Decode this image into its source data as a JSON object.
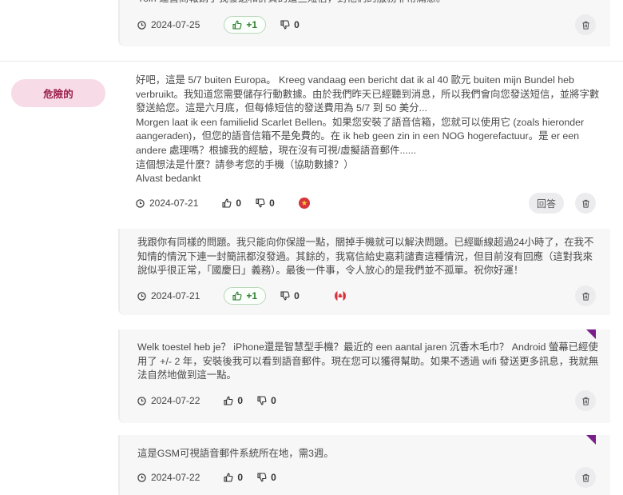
{
  "badge": {
    "label": "危險的"
  },
  "reply_label": "回答",
  "posts": [
    {
      "text": "Yoin 運營商報銷了我發送和計費的這些短信，對他們的服務非常滿意。",
      "date": "2024-07-25",
      "likes": "+1",
      "dislikes": "0"
    },
    {
      "text": "好吧，這是 5/7 buiten Europa。 Kreeg vandaag een bericht dat ik al 40 歐元 buiten mijn Bundel heb verbruikt。我知道您需要儲存行動數據。由於我們昨天已經聽到消息，所以我們會向您發送短信，並將字數發送給您。這是六月底，但每條短信的發送費用為 5/7 到 50 美分...\nMorgen laat ik een familielid Scarlet Bellen。如果您安裝了語音信箱，您就可以使用它 (zoals hieronder aangeraden)，但您的語音信箱不是免費的。在 ik heb geen zin in een NOG hogerefactuur。是 er een andere 處理嗎？根據我的經驗，現在沒有可視/虛擬語音郵件......\n這個想法是什麼？請參考您的手機（協助數據？）\nAlvast bedankt",
      "date": "2024-07-21",
      "likes": "0",
      "dislikes": "0"
    },
    {
      "text": "我跟你有同樣的問題。我只能向你保證一點，關掉手機就可以解決問題。已經斷線超過24小時了，在我不知情的情況下連一封簡訊都沒發過。其餘的，我寫信給史嘉莉譴責這種情況，但目前沒有回應（這對我來說似乎很正常，「國慶日」義務）。最後一件事，令人放心的是我們並不孤單。祝你好運！",
      "date": "2024-07-21",
      "likes": "+1",
      "dislikes": "0"
    },
    {
      "text": "Welk toestel heb je？ iPhone還是智慧型手機？最近的 een aantal jaren 沉香木毛巾？ Android 螢幕已經使用了 +/- 2 年，安裝後我可以看到語音郵件。現在您可以獲得幫助。如果不透過 wifi 發送更多訊息，我就無法自然地做到這一點。",
      "date": "2024-07-22",
      "likes": "0",
      "dislikes": "0"
    },
    {
      "text": "這是GSM可視語音郵件系統所在地，需3週。",
      "date": "2024-07-22",
      "likes": "0",
      "dislikes": "0"
    }
  ],
  "colors": {
    "accent_purple": "#7a1f8a",
    "danger_badge_bg": "#f7dbe6",
    "danger_badge_text": "#9b1c4a",
    "like_green": "#2f7d2f"
  }
}
